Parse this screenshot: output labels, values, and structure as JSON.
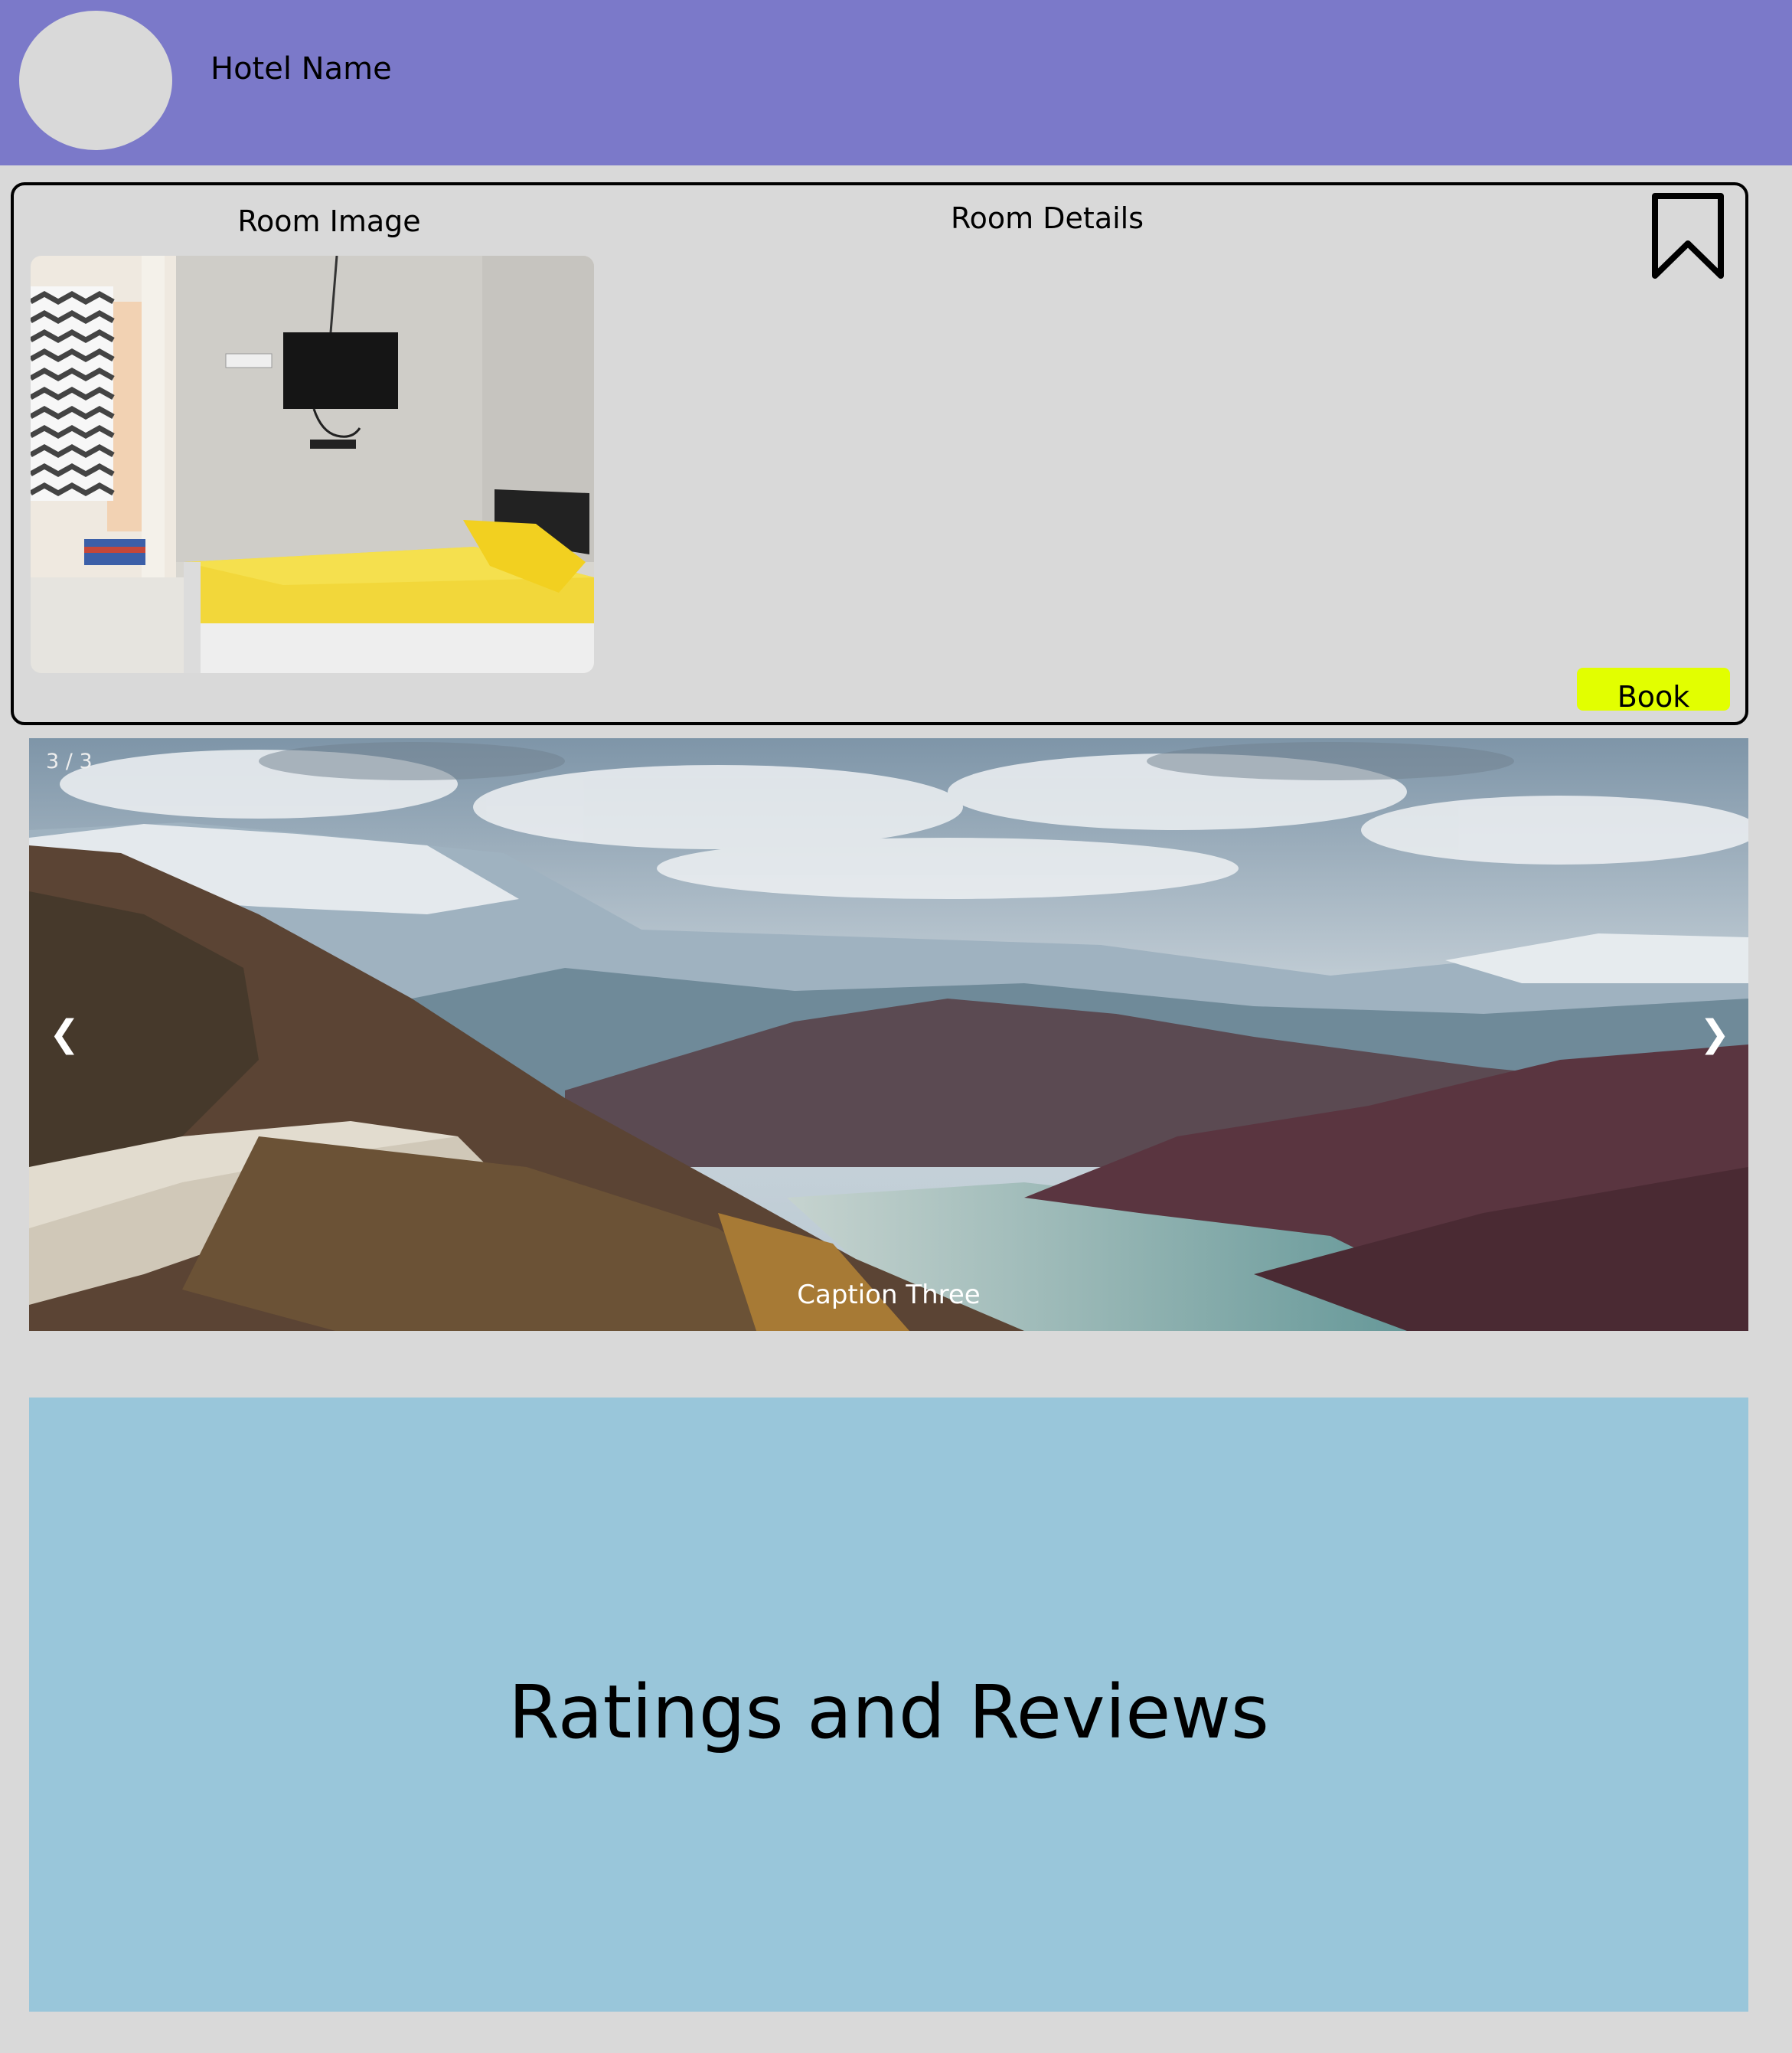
{
  "header": {
    "hotel_name": "Hotel Name",
    "background_color": "#7b79c9"
  },
  "room_card": {
    "image_label": "Room Image",
    "details_label": "Room Details",
    "bookmark_icon": "bookmark-icon",
    "book_label": "Book",
    "book_color": "#e2ff00"
  },
  "slideshow": {
    "counter": "3 / 3",
    "prev_arrow": "❮",
    "next_arrow": "❯",
    "caption": "Caption Three"
  },
  "ratings": {
    "title": "Ratings and Reviews",
    "background_color": "#99c6da"
  }
}
